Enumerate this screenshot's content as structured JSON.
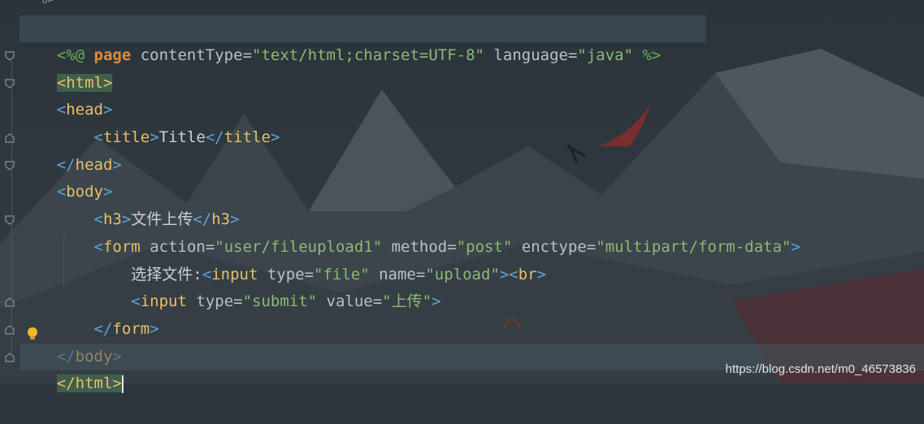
{
  "editor": {
    "top_fragment": "--%>",
    "lines": [
      {
        "parts": [
          "<%@",
          " page",
          " contentType=",
          "\"text/html;charset=UTF-8\"",
          " language=",
          "\"java\"",
          " %>"
        ]
      },
      {
        "open": "<",
        "tag": "html",
        "close": ">"
      },
      {
        "open": "<",
        "tag": "head",
        "close": ">"
      },
      {
        "indent": "    ",
        "open": "<",
        "tag": "title",
        "mid": ">",
        "text": "Title",
        "endopen": "</",
        "endtag": "title",
        "endclose": ">"
      },
      {
        "open": "</",
        "tag": "head",
        "close": ">"
      },
      {
        "open": "<",
        "tag": "body",
        "close": ">"
      },
      {
        "indent": "    ",
        "open": "<",
        "tag": "h3",
        "mid": ">",
        "text": "文件上传",
        "endopen": "</",
        "endtag": "h3",
        "endclose": ">"
      },
      {
        "indent": "    ",
        "open": "<",
        "tag": "form",
        "a1": " action=",
        "v1": "\"user/fileupload1\"",
        "a2": " method=",
        "v2": "\"post\"",
        "a3": " enctype=",
        "v3": "\"multipart/form-data\"",
        "close": ">"
      },
      {
        "indent": "        ",
        "text": "选择文件:",
        "open": "<",
        "tag": "input",
        "a1": " type=",
        "v1": "\"file\"",
        "a2": " name=",
        "v2": "\"upload\"",
        "close": ">",
        "open2": "<",
        "tag2": "br",
        "close2": ">"
      },
      {
        "indent": "        ",
        "open": "<",
        "tag": "input",
        "a1": " type=",
        "v1": "\"submit\"",
        "a2": " value=",
        "v2": "\"上传\"",
        "close": ">"
      },
      {
        "indent": "    ",
        "open": "</",
        "tag": "form",
        "close": ">"
      },
      {
        "open": "</",
        "tag": "body",
        "close": ">"
      },
      {
        "open": "</",
        "tag": "html",
        "close": ">"
      }
    ]
  },
  "watermark": "https://blog.csdn.net/m0_46573836",
  "colors": {
    "tag": "#e8bf6a",
    "bracket": "#5fa3d6",
    "string": "#8fb874",
    "attribute": "#b7c1c6",
    "directive": "#6aae57",
    "keyword": "#e08a3b"
  }
}
